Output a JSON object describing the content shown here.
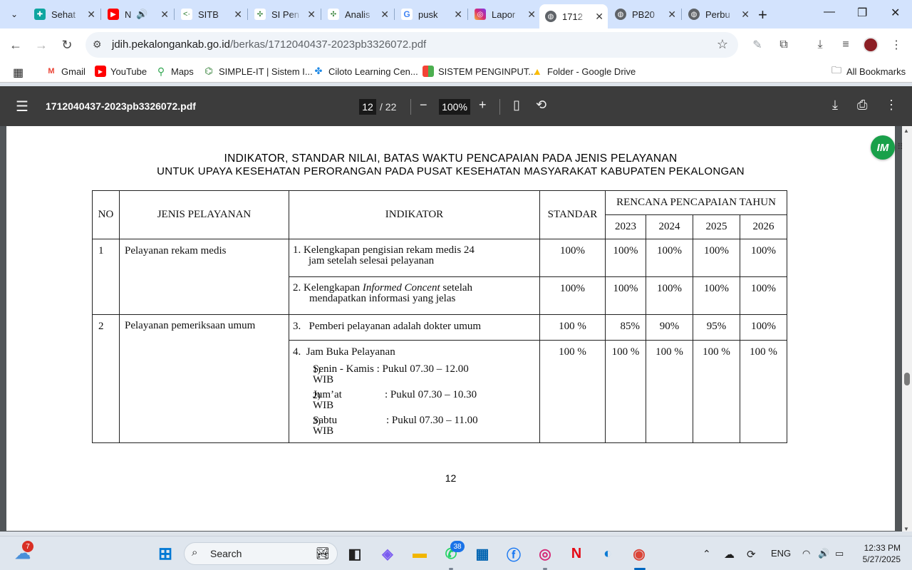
{
  "browser": {
    "tabs": [
      {
        "label": "Sehat",
        "icon": "health-app-icon",
        "color": "#0ea5a0"
      },
      {
        "label": "N",
        "icon": "youtube-icon",
        "color": "#ff0000",
        "muted_audio": true
      },
      {
        "label": "SITB",
        "icon": "sitb-icon",
        "color": "#2e7d32"
      },
      {
        "label": "SI Pen",
        "icon": "sipen-icon",
        "color": "#2e7d32"
      },
      {
        "label": "Analis",
        "icon": "analisis-icon",
        "color": "#2e7d32"
      },
      {
        "label": "pusk",
        "icon": "google-icon",
        "color": "#4285f4"
      },
      {
        "label": "Lapor",
        "icon": "instagram-icon",
        "color": "#d62976"
      },
      {
        "label": "1712",
        "icon": "globe-icon",
        "color": "#5f6368",
        "active": true
      },
      {
        "label": "PB20",
        "icon": "globe-icon",
        "color": "#5f6368"
      },
      {
        "label": "Perbu",
        "icon": "globe-icon",
        "color": "#5f6368"
      }
    ],
    "url_host": "jdih.pekalongankab.go.id",
    "url_path": "/berkas/1712040437-2023pb3326072.pdf",
    "bookmarks": [
      {
        "label": "Gmail",
        "icon": "gmail-icon"
      },
      {
        "label": "YouTube",
        "icon": "youtube-icon"
      },
      {
        "label": "Maps",
        "icon": "maps-icon"
      },
      {
        "label": "SIMPLE-IT | Sistem I...",
        "icon": "simple-it-icon"
      },
      {
        "label": "Ciloto Learning Cen...",
        "icon": "ciloto-icon"
      },
      {
        "label": "SISTEM PENGINPUT...",
        "icon": "sistem-icon"
      },
      {
        "label": "Folder - Google Drive",
        "icon": "google-drive-icon"
      }
    ],
    "all_bookmarks": "All Bookmarks"
  },
  "pdf": {
    "filename": "1712040437-2023pb3326072.pdf",
    "page_current": "12",
    "page_total": "/ 22",
    "zoom": "100%"
  },
  "document": {
    "heading_line1": "INDIKATOR, STANDAR NILAI, BATAS WAKTU PENCAPAIAN PADA JENIS PELAYANAN",
    "heading_line2": "UNTUK UPAYA KESEHATAN PERORANGAN PADA PUSAT KESEHATAN MASYARAKAT KABUPATEN PEKALONGAN",
    "table": {
      "headers": {
        "no": "NO",
        "jenis": "JENIS PELAYANAN",
        "indikator": "INDIKATOR",
        "standar": "STANDAR",
        "rencana": "RENCANA PENCAPAIAN TAHUN",
        "years": [
          "2023",
          "2024",
          "2025",
          "2026"
        ]
      },
      "groups": [
        {
          "no": "1",
          "jenis": "Pelayanan rekam medis",
          "rows": [
            {
              "num": "1.",
              "ind_a": "Kelengkapan pengisian rekam medis 24",
              "ind_b": "jam setelah selesai pelayanan",
              "standar": "100%",
              "years": [
                "100%",
                "100%",
                "100%",
                "100%"
              ]
            },
            {
              "num": "2.",
              "ind_a": "Kelengkapan Informed Concent setelah",
              "ind_b": "mendapatkan informasi yang jelas",
              "standar": "100%",
              "years": [
                "100%",
                "100%",
                "100%",
                "100%"
              ]
            }
          ]
        },
        {
          "no": "2",
          "jenis": "Pelayanan pemeriksaan umum",
          "rows": [
            {
              "num": "3.",
              "ind_a": "Pemberi pelayanan adalah dokter umum",
              "standar": "100 %",
              "years": [
                "85%",
                "90%",
                "95%",
                "100%"
              ]
            },
            {
              "num": "4.",
              "ind_a": "Jam Buka Pelayanan",
              "standar": "100 %",
              "years": [
                "100 %",
                "100 %",
                "100 %",
                "100 %"
              ],
              "sub": [
                {
                  "n": "1)",
                  "day": "Senin - Kamis",
                  "time": ": Pukul 07.30 – 12.00",
                  "wib": "WIB"
                },
                {
                  "n": "2)",
                  "day": "Jum’at",
                  "time": ": Pukul 07.30 – 10.30",
                  "wib": "WIB"
                },
                {
                  "n": "3)",
                  "day": "Sabtu",
                  "time": ": Pukul 07.30 – 11.00",
                  "wib": "WIB"
                }
              ]
            }
          ]
        }
      ]
    },
    "page_number": "12"
  },
  "ext_badge": "IM",
  "taskbar": {
    "search_label": "Search",
    "weather_badge": "7",
    "whatsapp_badge": "38",
    "lang": "ENG",
    "time": "12:33 PM",
    "date": "5/27/2025"
  },
  "colors": {
    "tabstrip": "#d3e3fd",
    "pdfbar": "#3c3c3c",
    "viewer": "#525659",
    "ext": "#19a04a"
  }
}
